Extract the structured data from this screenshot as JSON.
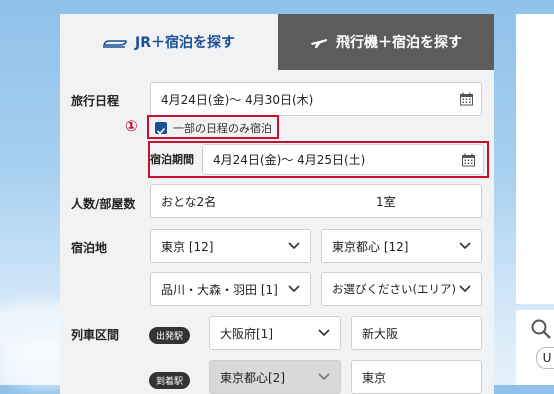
{
  "tabs": {
    "jr_hotel": "JR＋宿泊を探す",
    "flight_hotel": "飛行機＋宿泊を探す"
  },
  "travel_dates": {
    "label": "旅行日程",
    "value": "4月24日(金)～ 4月30日(木)"
  },
  "partial_stay": {
    "marker": "①",
    "label": "一部の日程のみ宿泊",
    "checked": true
  },
  "stay_period": {
    "label": "宿泊期間",
    "value": "4月24日(金)～ 4月25日(土)"
  },
  "guests": {
    "label": "人数/部屋数",
    "people": "おとな2名",
    "rooms": "1室"
  },
  "destination": {
    "label": "宿泊地",
    "prefecture": "東京 [12]",
    "area": "東京都心 [12]",
    "subarea": "品川・大森・羽田 [1]",
    "area_placeholder": "お選びください(エリア)"
  },
  "train": {
    "label": "列車区間",
    "departure_badge": "出発駅",
    "departure_region": "大阪府[1]",
    "departure_station": "新大阪",
    "arrival_badge": "到着駅",
    "arrival_region": "東京都心[2]",
    "arrival_station": "東京"
  },
  "side": {
    "letter": "U"
  },
  "colors": {
    "accent_blue": "#1a4f96",
    "highlight_red": "#c8102e",
    "inactive_tab": "#5c5c5c"
  }
}
